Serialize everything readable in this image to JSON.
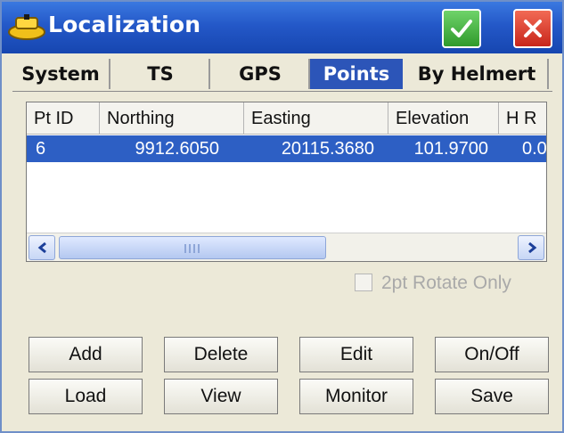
{
  "window": {
    "title": "Localization",
    "ok_label": "✓",
    "close_label": "✕"
  },
  "tabs": [
    {
      "label": "System",
      "selected": false
    },
    {
      "label": "TS",
      "selected": false
    },
    {
      "label": "GPS",
      "selected": false
    },
    {
      "label": "Points",
      "selected": true
    },
    {
      "label": "By Helmert",
      "selected": false
    }
  ],
  "points_list": {
    "columns": [
      "Pt ID",
      "Northing",
      "Easting",
      "Elevation",
      "H R"
    ],
    "rows": [
      {
        "pt_id": "6",
        "northing": "9912.6050",
        "easting": "20115.3680",
        "elevation": "101.9700",
        "h_r": "0.0"
      }
    ],
    "selected_row": 0
  },
  "rotate_option": {
    "label": "2pt Rotate Only",
    "checked": false,
    "enabled": false
  },
  "buttons": {
    "add": "Add",
    "delete": "Delete",
    "edit": "Edit",
    "on_off": "On/Off",
    "load": "Load",
    "view": "View",
    "monitor": "Monitor",
    "save": "Save"
  },
  "colors": {
    "title_bar": "#2458c8",
    "selection": "#2d5fc4",
    "ok_green": "#2f9a2b",
    "close_red": "#c8261b"
  },
  "icons": {
    "app": "satellite-icon",
    "ok": "check-icon",
    "close": "close-icon",
    "scroll_left": "chevron-left-icon",
    "scroll_right": "chevron-right-icon"
  }
}
